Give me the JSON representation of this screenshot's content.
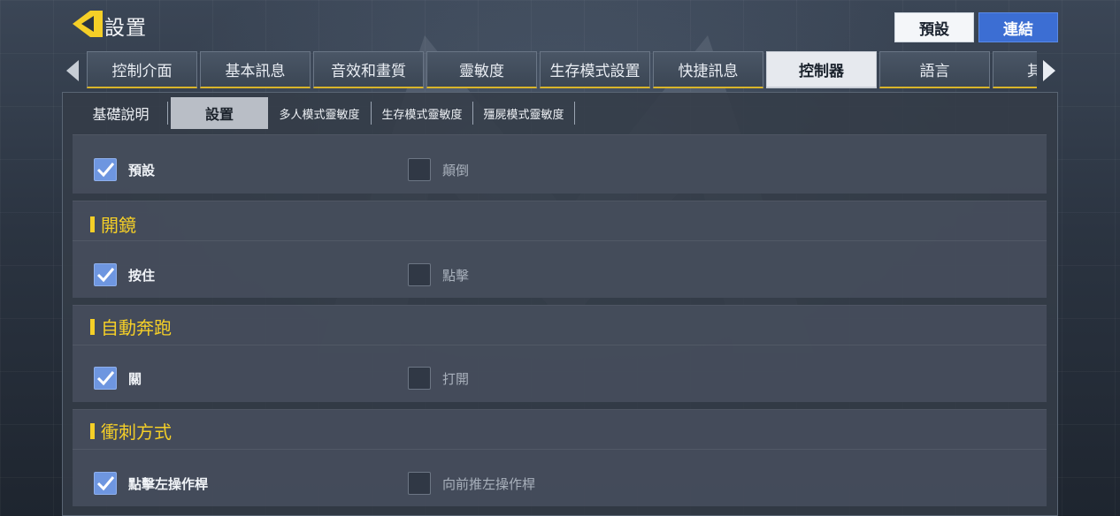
{
  "header": {
    "title": "設置",
    "preset_button": "預設",
    "link_button": "連結"
  },
  "tabs": [
    {
      "label": "控制介面"
    },
    {
      "label": "基本訊息"
    },
    {
      "label": "音效和畫質"
    },
    {
      "label": "靈敏度"
    },
    {
      "label": "生存模式設置"
    },
    {
      "label": "快捷訊息"
    },
    {
      "label": "控制器"
    },
    {
      "label": "語言"
    },
    {
      "label": "其"
    }
  ],
  "active_tab": "控制器",
  "subtabs": [
    {
      "label": "基礎說明"
    },
    {
      "label": "設置"
    },
    {
      "label": "多人模式靈敏度"
    },
    {
      "label": "生存模式靈敏度"
    },
    {
      "label": "殭屍模式靈敏度"
    }
  ],
  "active_subtab": "設置",
  "sections": {
    "mode": {
      "options": [
        {
          "label": "預設",
          "checked": true
        },
        {
          "label": "顛倒",
          "checked": false
        }
      ]
    },
    "aim": {
      "title": "開鏡",
      "options": [
        {
          "label": "按住",
          "checked": true
        },
        {
          "label": "點擊",
          "checked": false
        }
      ]
    },
    "auto_sprint": {
      "title": "自動奔跑",
      "options": [
        {
          "label": "關",
          "checked": true
        },
        {
          "label": "打開",
          "checked": false
        }
      ]
    },
    "sprint_method": {
      "title": "衝刺方式",
      "options": [
        {
          "label": "點擊左操作桿",
          "checked": true
        },
        {
          "label": "向前推左操作桿",
          "checked": false
        }
      ]
    }
  },
  "colors": {
    "accent_yellow": "#f5cf27",
    "checkbox_on": "#6e96e0",
    "link_button": "#3c6ed3"
  }
}
